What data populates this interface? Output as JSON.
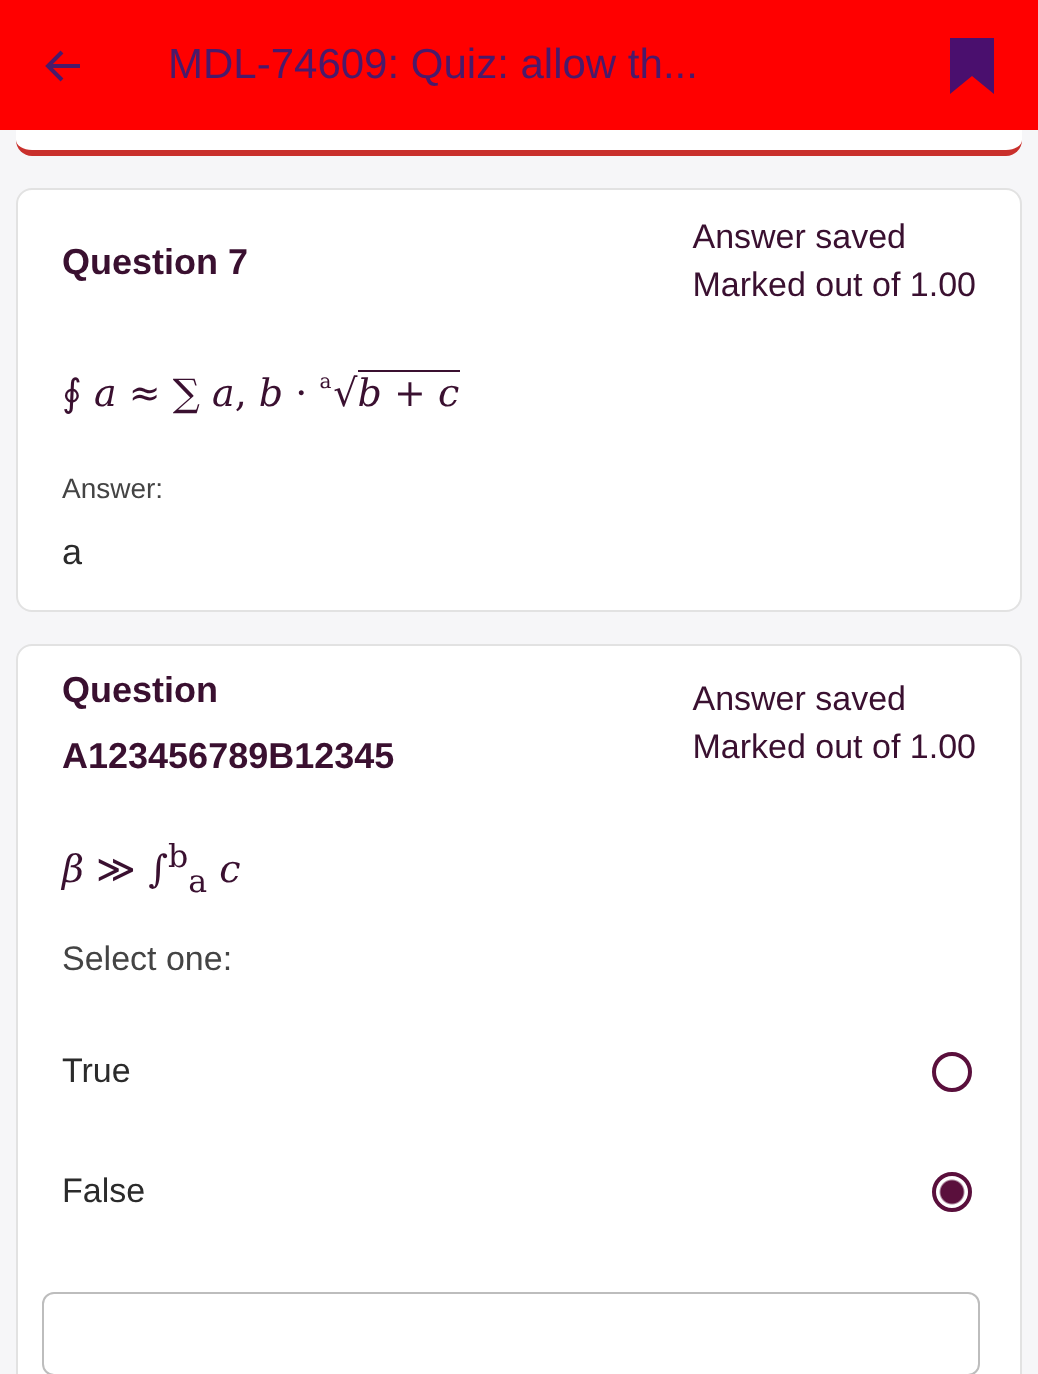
{
  "app_bar": {
    "title": "MDL-74609: Quiz: allow th..."
  },
  "questions": [
    {
      "title": "Question 7",
      "status": "Answer saved",
      "mark": "Marked out of 1.00",
      "kind": "short_answer",
      "formula": [
        {
          "kind": "text",
          "text": "∮ *a* ≈ ∑ *a*, *b* · "
        },
        {
          "kind": "radical",
          "index": "a",
          "sign": "√",
          "radicand": "b + c"
        }
      ],
      "answer_label": "Answer:",
      "answer": "a"
    },
    {
      "title": "Question",
      "subtitle": "A123456789B12345",
      "status": "Answer saved",
      "mark": "Marked out of 1.00",
      "kind": "true_false",
      "formula": [
        {
          "kind": "text",
          "text": "*β* ≫ ∫$^{b}$$_{a}$ *c*"
        }
      ],
      "prompt": "Select one:",
      "options": [
        {
          "label": "True",
          "selected": false
        },
        {
          "label": "False",
          "selected": true
        }
      ]
    }
  ]
}
